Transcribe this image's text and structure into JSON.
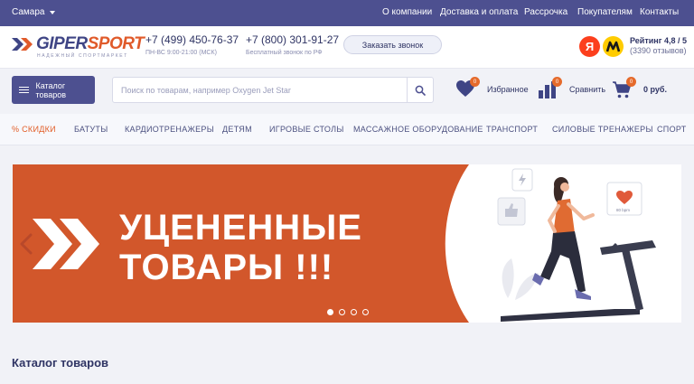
{
  "topbar": {
    "city": "Самара",
    "nav": [
      "О компании",
      "Доставка и оплата",
      "Рассрочка",
      "Покупателям",
      "Контакты"
    ]
  },
  "header": {
    "logo_text_a": "GIPER",
    "logo_text_b": "SPORT",
    "logo_tagline": "НАДЕЖНЫЙ СПОРТМАРКЕТ",
    "phone1": "+7 (499) 450-76-37",
    "phone1_note": "ПН-ВС 9:00-21:00 (МСК)",
    "phone2": "+7 (800) 301-91-27",
    "phone2_note": "Бесплатный звонок по РФ",
    "callback_label": "Заказать звонок",
    "yandex_letter": "Я",
    "rating": "Рейтинг 4,8 / 5",
    "reviews": "(3390 отзывов)"
  },
  "search": {
    "catalog_label": "Каталог товаров",
    "placeholder": "Поиск по товарам, например Oxygen Jet Star"
  },
  "tools": {
    "favorites_label": "Избранное",
    "favorites_count": "0",
    "compare_label": "Сравнить",
    "compare_count": "0",
    "cart_label": "0 руб.",
    "cart_count": "0"
  },
  "categories": [
    "% СКИДКИ",
    "БАТУТЫ",
    "КАРДИОТРЕНАЖЕРЫ",
    "ДЕТЯМ",
    "ИГРОВЫЕ СТОЛЫ",
    "МАССАЖНОЕ ОБОРУДОВАНИЕ",
    "ТРАНСПОРТ",
    "СИЛОВЫЕ ТРЕНАЖЕРЫ",
    "СПОРТ"
  ],
  "banner": {
    "line1": "УЦЕНЕННЫЕ",
    "line2": "ТОВАРЫ !!!",
    "heart_rate": "80 bpm",
    "slides": 4,
    "active_slide": 0
  },
  "section": {
    "title": "Каталог товаров"
  },
  "colors": {
    "topbar": "#4d5090",
    "accent": "#e56a2b",
    "banner": "#d2572b"
  }
}
